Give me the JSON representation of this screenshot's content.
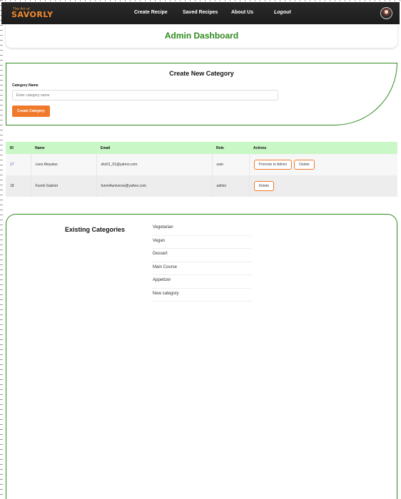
{
  "brand": {
    "small": "The Art of",
    "name": "SAVORLY",
    "accent_color": "#f28a2e"
  },
  "navbar": {
    "links": [
      "Create Recipe",
      "Saved Recipes",
      "About Us",
      "Logout"
    ],
    "avatar_icon": "user-avatar"
  },
  "page": {
    "title": "Admin Dashboard",
    "title_color": "#2f8a1f"
  },
  "create_category": {
    "title": "Create New Category",
    "label": "Category Name",
    "placeholder": "Enter category name",
    "button": "Create Category",
    "button_color": "#f07a2c"
  },
  "users_table": {
    "headers": [
      "ID",
      "Name",
      "Email",
      "Role",
      "Actions"
    ],
    "rows": [
      {
        "id": "17",
        "name": "Leez Aloyatus",
        "email": "eliz01_01@yahoo.com",
        "role": "user",
        "actions": [
          "Promote to Admin",
          "Delete"
        ]
      },
      {
        "id": "18",
        "name": "Funmi Gabriel",
        "email": "funmi4universe@yahoo.com",
        "role": "admin",
        "actions": [
          "Delete"
        ]
      }
    ],
    "header_color": "#c9f7c6"
  },
  "existing_categories": {
    "title": "Existing Categories",
    "items": [
      "Vegetarian",
      "Vegan",
      "Dessert",
      "Main Course",
      "Appetizer",
      "New category"
    ]
  }
}
